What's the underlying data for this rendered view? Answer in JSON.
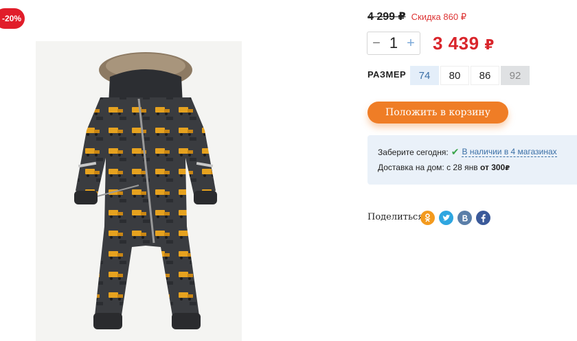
{
  "badge": {
    "discount_label": "-20%"
  },
  "pricing": {
    "old_price": "4 299",
    "old_currency": "₽",
    "discount_text": "Скидка 860",
    "discount_currency": "₽",
    "price": "3 439",
    "price_currency": "₽"
  },
  "quantity": {
    "minus": "−",
    "value": "1",
    "plus": "+"
  },
  "size": {
    "label": "РАЗМЕР",
    "options": [
      {
        "label": "74",
        "state": "selected"
      },
      {
        "label": "80",
        "state": "available"
      },
      {
        "label": "86",
        "state": "available"
      },
      {
        "label": "92",
        "state": "unavailable"
      }
    ]
  },
  "cart": {
    "button_label": "Положить в корзину"
  },
  "delivery": {
    "pickup_label": "Заберите сегодня:",
    "stores_link": "В наличии в 4 магазинах",
    "home_label": "Доставка на дом: с 28 янв",
    "home_from": "от 300",
    "home_currency": "₽"
  },
  "share": {
    "label": "Поделиться",
    "networks": [
      {
        "name": "odnoklassniki-icon",
        "glyph": "ok",
        "color": "#f39a1e"
      },
      {
        "name": "twitter-icon",
        "glyph": "t",
        "color": "#2ea6e0"
      },
      {
        "name": "vk-icon",
        "glyph": "B",
        "color": "#5a7ea8"
      },
      {
        "name": "facebook-icon",
        "glyph": "f",
        "color": "#3b5a9a"
      }
    ]
  },
  "colors": {
    "accent_orange": "#ef7d26",
    "price_red": "#d9252b",
    "badge_red": "#e11d2a",
    "link_blue": "#3a6fa6"
  }
}
